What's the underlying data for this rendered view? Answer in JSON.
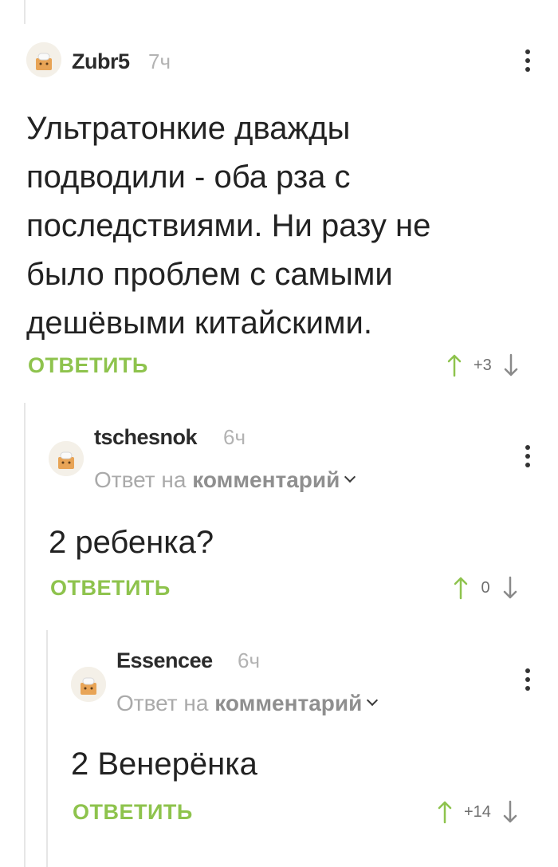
{
  "comments": [
    {
      "username": "Zubr5",
      "time": "7ч",
      "text": "Ультратонкие дважды\nподводили - оба рза с\nпоследствиями. Ни разу не\nбыло проблем с самыми\nдешёвыми китайскими.",
      "reply_label": "ОТВЕТИТЬ",
      "score": "+3",
      "reply_to": null
    },
    {
      "username": "tschesnok",
      "time": "6ч",
      "reply_to": {
        "prefix": "Ответ на",
        "link": "комментарий"
      },
      "text": "2 ребенка?",
      "reply_label": "ОТВЕТИТЬ",
      "score": "0"
    },
    {
      "username": "Essencee",
      "time": "6ч",
      "reply_to": {
        "prefix": "Ответ на",
        "link": "комментарий"
      },
      "text": "2 Венерёнка",
      "reply_label": "ОТВЕТИТЬ",
      "score": "+14"
    }
  ],
  "colors": {
    "accent_green": "#8ec34d",
    "username": "#2b2b2b",
    "muted": "#b3b3b3",
    "thread_line": "#e6e6e6"
  },
  "icons": {
    "avatar": "default-avatar-icon",
    "more": "more-vertical-icon",
    "upvote": "arrow-up-icon",
    "downvote": "arrow-down-icon",
    "expand": "chevron-down-icon"
  }
}
